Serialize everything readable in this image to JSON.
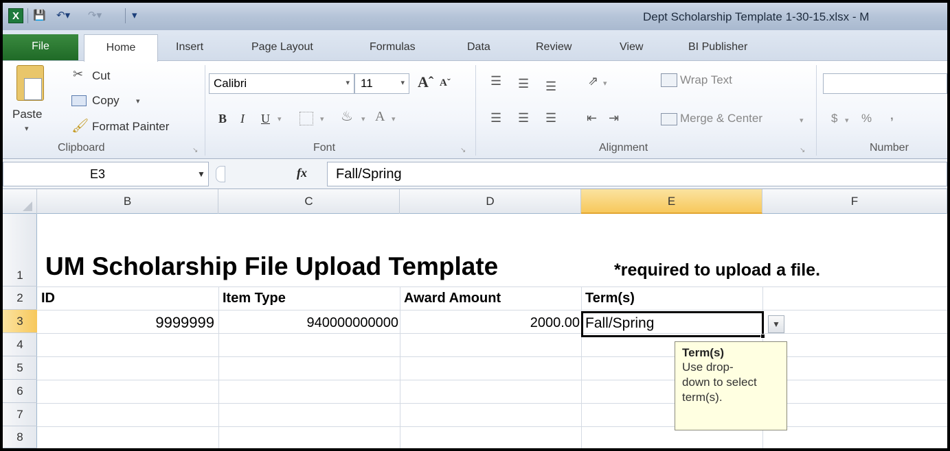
{
  "titlebar": {
    "title": "Dept Scholarship Template 1-30-15.xlsx - M",
    "app_icon": "excel-icon"
  },
  "tabs": [
    {
      "label": "File"
    },
    {
      "label": "Home"
    },
    {
      "label": "Insert"
    },
    {
      "label": "Page Layout"
    },
    {
      "label": "Formulas"
    },
    {
      "label": "Data"
    },
    {
      "label": "Review"
    },
    {
      "label": "View"
    },
    {
      "label": "BI Publisher"
    }
  ],
  "ribbon": {
    "clipboard": {
      "paste": "Paste",
      "cut": "Cut",
      "copy": "Copy",
      "format_painter": "Format Painter",
      "label": "Clipboard"
    },
    "font": {
      "family": "Calibri",
      "size": "11",
      "label": "Font"
    },
    "alignment": {
      "wrap_text": "Wrap Text",
      "merge_center": "Merge & Center",
      "label": "Alignment"
    },
    "number": {
      "currency": "$",
      "percent": "%",
      "comma": ",",
      "label": "Number"
    }
  },
  "formula_bar": {
    "name_box": "E3",
    "fx": "fx",
    "value": "Fall/Spring"
  },
  "columns": [
    "B",
    "C",
    "D",
    "E",
    "F"
  ],
  "rows": [
    "1",
    "2",
    "3",
    "4",
    "5",
    "6",
    "7",
    "8"
  ],
  "sheet": {
    "title": "UM Scholarship File Upload Template",
    "note": "*required to upload a file.",
    "headers": {
      "id": "ID",
      "item_type": "Item Type",
      "award_amount": "Award Amount",
      "terms": "Term(s)"
    },
    "row3": {
      "id": "9999999",
      "item_type": "940000000000",
      "award_amount": "2000.00",
      "terms": "Fall/Spring"
    }
  },
  "tooltip": {
    "title": "Term(s)",
    "line1": "Use drop-",
    "line2": "down to select",
    "line3": "term(s)."
  },
  "colors": {
    "file_tab": "#2a7a32",
    "selected_header": "#f7c85c",
    "tooltip_bg": "#ffffe1"
  }
}
